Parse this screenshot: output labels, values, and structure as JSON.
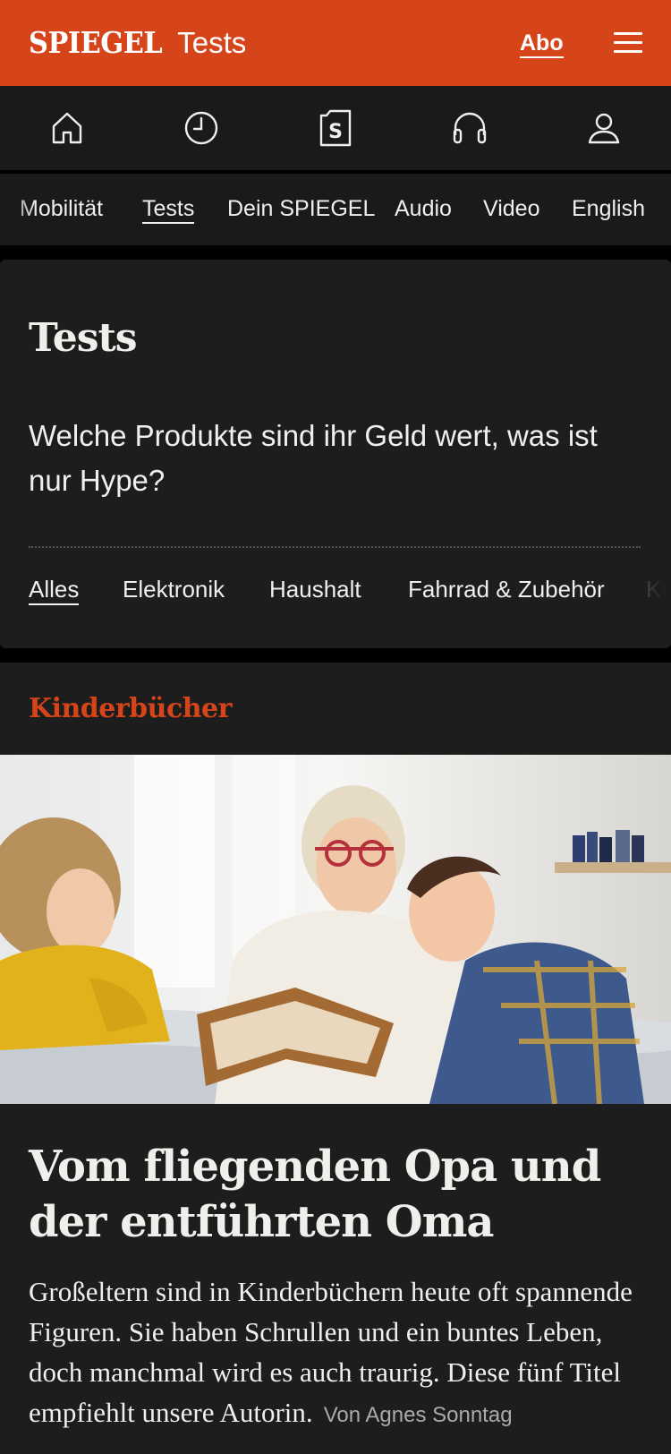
{
  "header": {
    "logo": "SPIEGEL",
    "section": "Tests",
    "abo_label": "Abo",
    "brand_color": "#d6441a"
  },
  "icon_nav": [
    {
      "icon": "home-icon"
    },
    {
      "icon": "history-clock-icon"
    },
    {
      "icon": "spiegel-plus-icon"
    },
    {
      "icon": "headphones-icon"
    },
    {
      "icon": "account-icon"
    }
  ],
  "text_nav": {
    "items": [
      "Mobilität",
      "Tests",
      "Dein SPIEGEL",
      "Audio",
      "Video",
      "English"
    ],
    "active": "Tests"
  },
  "section": {
    "title": "Tests",
    "description": "Welche Produkte sind ihr Geld wert, was ist nur Hype?",
    "filters": [
      "Alles",
      "Elektronik",
      "Haushalt",
      "Fahrrad & Zubehör",
      "Kü"
    ],
    "active_filter": "Alles"
  },
  "article": {
    "kicker": "Kinderbücher",
    "headline": "Vom fliegenden Opa und der entführten Oma",
    "teaser": "Großeltern sind in Kinderbüchern heute oft spannende Figuren. Sie haben Schrullen und ein buntes Leben, doch manchmal wird es auch traurig. Diese fünf Titel empfiehlt unsere Autorin.",
    "byline": "Von Agnes Sonntag"
  }
}
